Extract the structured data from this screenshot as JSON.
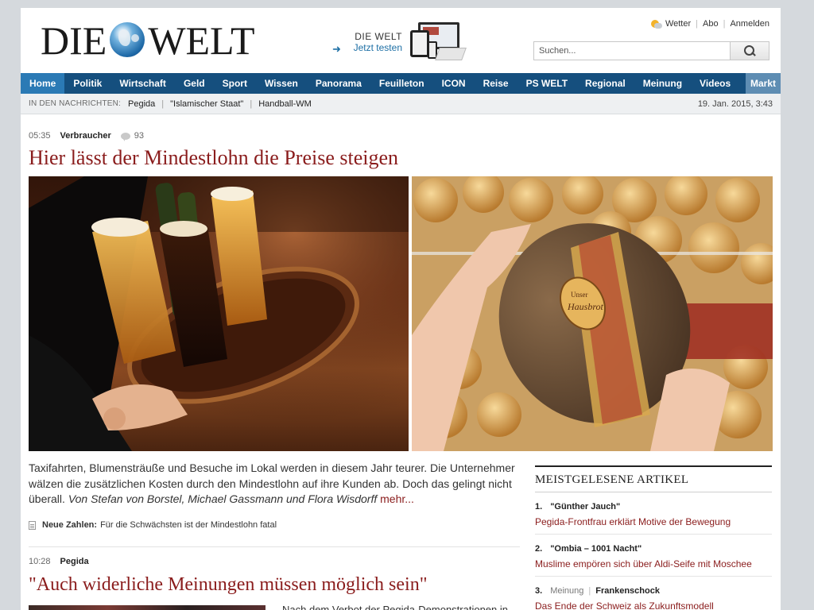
{
  "header": {
    "logo_left": "DIE",
    "logo_right": "WELT",
    "promo_brand": "DIE WELT",
    "promo_cta": "Jetzt testen",
    "links": [
      "Wetter",
      "Abo",
      "Anmelden"
    ],
    "search_placeholder": "Suchen..."
  },
  "nav": {
    "items": [
      "Home",
      "Politik",
      "Wirtschaft",
      "Geld",
      "Sport",
      "Wissen",
      "Panorama",
      "Feuilleton",
      "ICON",
      "Reise",
      "PS WELT",
      "Regional",
      "Meinung",
      "Videos",
      "Markt"
    ],
    "active": "Home"
  },
  "ticker": {
    "label": "IN DEN NACHRICHTEN:",
    "items": [
      "Pegida",
      "\"Islamischer Staat\"",
      "Handball-WM"
    ],
    "date": "19. Jan. 2015, 3:43"
  },
  "lead_article": {
    "time": "05:35",
    "category": "Verbraucher",
    "comments": "93",
    "headline": "Hier lässt der Mindestlohn die Preise steigen",
    "lede": "Taxifahrten, Blumensträuße und Besuche im Lokal werden in diesem Jahr teurer. Die Unternehmer wälzen die zusätzlichen Kosten durch den Mindestlohn auf ihre Kunden ab. Doch das gelingt nicht überall.",
    "author": "Von Stefan von Borstel, Michael Gassmann und Flora Wisdorff",
    "more": "mehr...",
    "related_label": "Neue Zahlen:",
    "related_text": "Für die Schwächsten ist der Mindestlohn fatal",
    "bread_label_1": "Unser",
    "bread_label_2": "Hausbrot"
  },
  "second_article": {
    "time": "10:28",
    "category": "Pegida",
    "headline": "\"Auch widerliche Meinungen müssen möglich sein\"",
    "teaser_start": "Nach dem Verbot der Pegida-Demonstrationen in"
  },
  "sidebar": {
    "title": "MEISTGELESENE ARTIKEL",
    "items": [
      {
        "num": "1.",
        "topic": "\"Günther Jauch\"",
        "link": "Pegida-Frontfrau erklärt Motive der Bewegung"
      },
      {
        "num": "2.",
        "topic": "\"Ombia – 1001 Nacht\"",
        "link": "Muslime empören sich über Aldi-Seife mit Moschee"
      },
      {
        "num": "3.",
        "section": "Meinung",
        "topic": "Frankenschock",
        "link": "Das Ende der Schweiz als Zukunftsmodell"
      }
    ]
  },
  "colors": {
    "nav_bg": "#154f7e",
    "nav_active": "#2b7ab5",
    "headline": "#8a1c1c",
    "accent_link": "#8a1c1c"
  }
}
